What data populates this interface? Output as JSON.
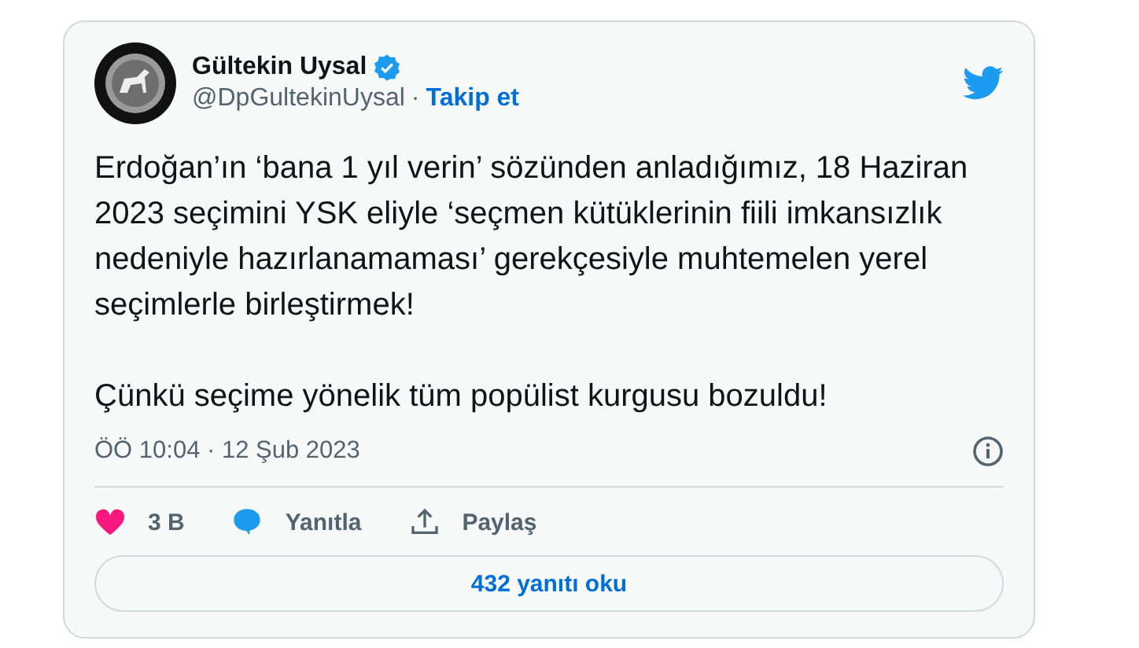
{
  "tweet": {
    "author": {
      "name": "Gültekin Uysal",
      "verified": true,
      "handle": "@DpGultekinUysal",
      "separator": "·",
      "follow": "Takip et"
    },
    "paragraphs": [
      "Erdoğan’ın ‘bana 1 yıl verin’ sözünden anladığımız, 18 Haziran 2023 seçimini YSK eliyle ‘seçmen kütüklerinin fiili imkansızlık nedeniyle hazırlanamaması’ gerekçesiyle muhtemelen yerel seçimlerle birleştirmek!",
      "Çünkü seçime yönelik tüm popülist kurgusu bozuldu!"
    ],
    "timestamp": "ÖÖ 10:04 · 12 Şub 2023",
    "actions": [
      {
        "kind": "like",
        "label": "3 B"
      },
      {
        "kind": "reply",
        "label": "Yanıtla"
      },
      {
        "kind": "share",
        "label": "Paylaş"
      }
    ],
    "replies_button": "432 yanıtı oku"
  }
}
